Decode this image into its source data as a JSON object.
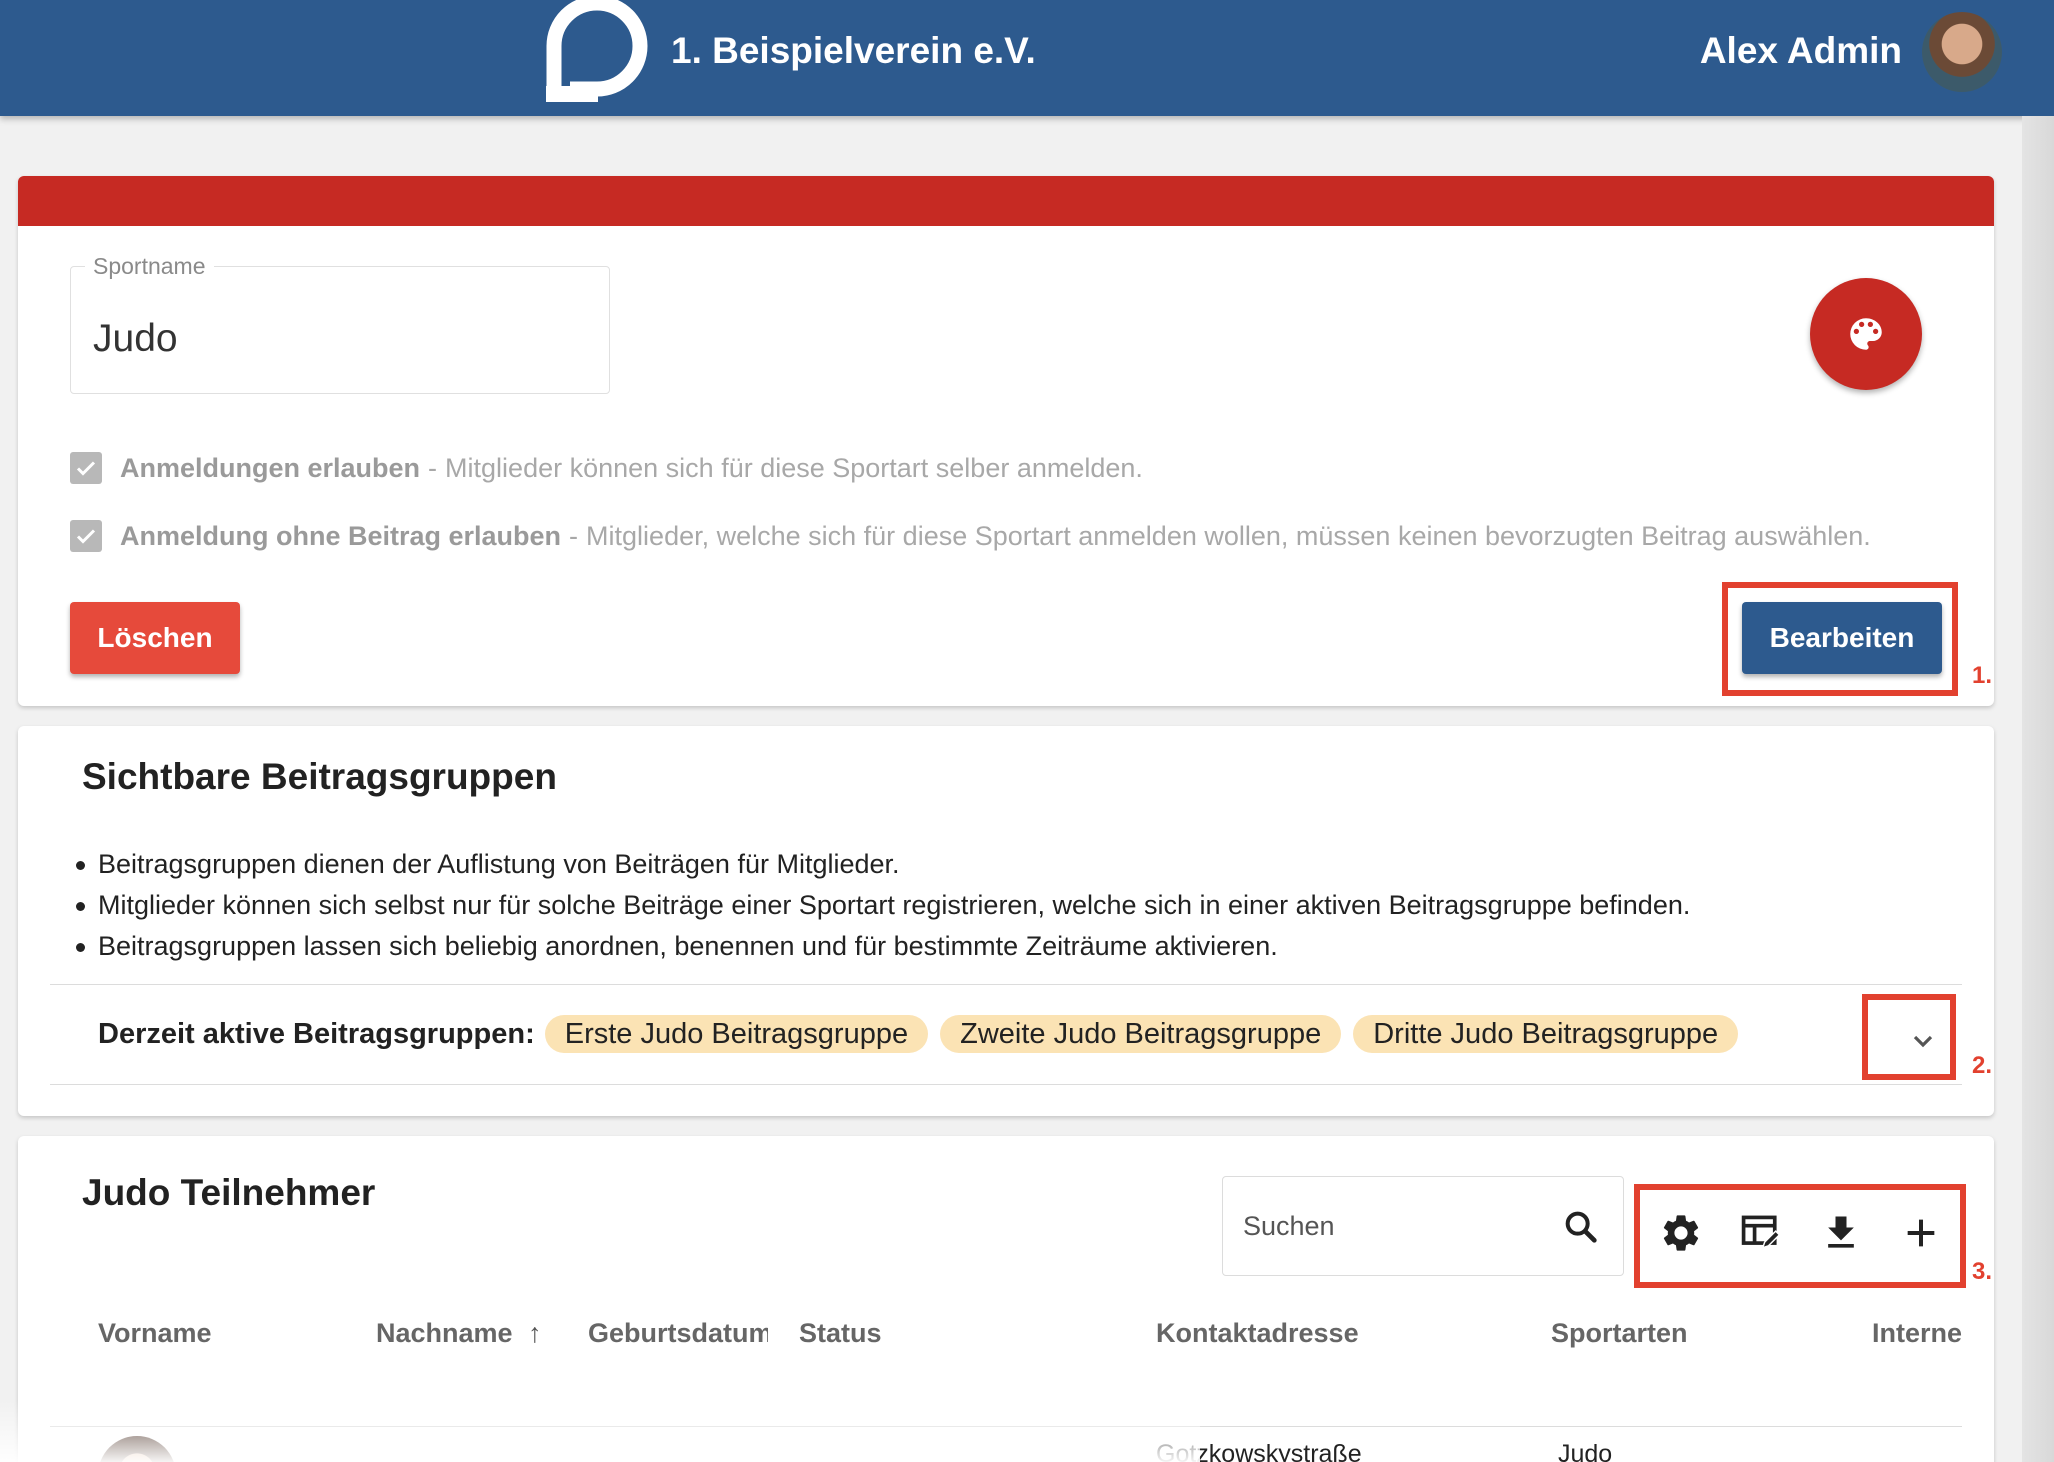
{
  "header": {
    "club_name": "1. Beispielverein e.V.",
    "user_name": "Alex Admin",
    "logo_icon": "speech-bubble-logo",
    "brand_color": "#2d5a8e"
  },
  "sport_card": {
    "accent_color": "#c62a23",
    "field_label": "Sportname",
    "field_value": "Judo",
    "palette_icon": "palette-icon",
    "options": [
      {
        "label": "Anmeldungen erlauben",
        "separator": "-",
        "description": "Mitglieder können sich für diese Sportart selber anmelden.",
        "checked": true
      },
      {
        "label": "Anmeldung ohne Beitrag erlauben",
        "separator": "-",
        "description": "Mitglieder, welche sich für diese Sportart anmelden wollen, müssen keinen bevorzugten Beitrag auswählen.",
        "checked": true
      }
    ],
    "delete_label": "Löschen",
    "edit_label": "Bearbeiten"
  },
  "fee_groups": {
    "title": "Sichtbare Beitragsgruppen",
    "bullets": [
      "Beitragsgruppen dienen der Auflistung von Beiträgen für Mitglieder.",
      "Mitglieder können sich selbst nur für solche Beiträge einer Sportart registrieren, welche sich in einer aktiven Beitragsgruppe befinden.",
      "Beitragsgruppen lassen sich beliebig anordnen, benennen und für bestimmte Zeiträume aktivieren."
    ],
    "active_label": "Derzeit aktive Beitragsgruppen:",
    "active_groups": [
      "Erste Judo Beitragsgruppe",
      "Zweite Judo Beitragsgruppe",
      "Dritte Judo Beitragsgruppe"
    ],
    "chip_color": "#fbe3b4"
  },
  "participants": {
    "title": "Judo Teilnehmer",
    "search_placeholder": "Suchen",
    "toolbar_icons": [
      "settings-icon",
      "edit-columns-icon",
      "download-icon",
      "add-icon"
    ],
    "columns": {
      "vorname": "Vorname",
      "nachname": "Nachname",
      "sort_arrow": "↑",
      "geburtsdatum": "Geburtsdatum",
      "status": "Status",
      "kontaktadresse": "Kontaktadresse",
      "sportarten": "Sportarten",
      "interne": "Interne"
    },
    "first_row": {
      "kontaktadresse": "Gotzkowskystraße",
      "sportarten": "Judo"
    }
  },
  "annotations": [
    "1.",
    "2.",
    "3."
  ],
  "annotation_color": "#e2412f"
}
